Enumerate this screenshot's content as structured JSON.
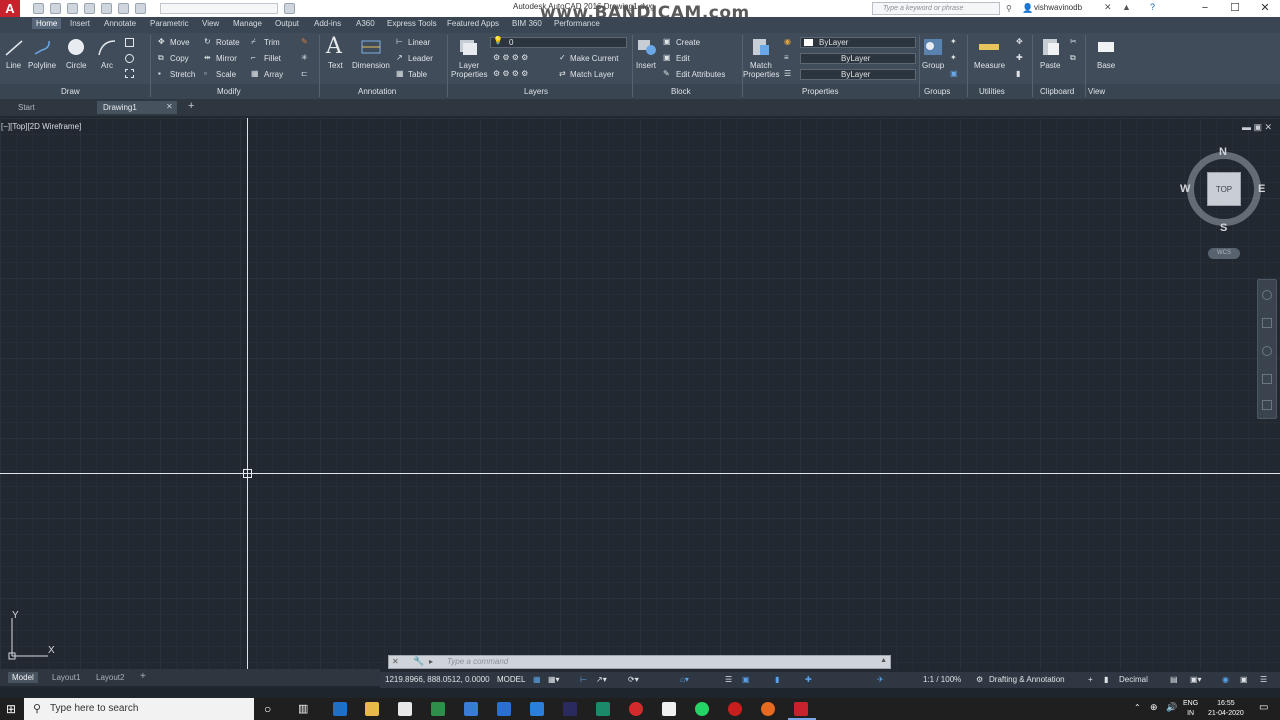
{
  "window": {
    "title": "Autodesk AutoCAD 2016    Drawing1.dwg",
    "watermark": "www.BANDICAM.com",
    "search_placeholder": "Type a keyword or phrase",
    "user": "vishwavinodb",
    "app_letter": "A"
  },
  "ribbon": {
    "tabs": [
      "Home",
      "Insert",
      "Annotate",
      "Parametric",
      "View",
      "Manage",
      "Output",
      "Add-ins",
      "A360",
      "Express Tools",
      "Featured Apps",
      "BIM 360",
      "Performance"
    ],
    "draw": {
      "line": "Line",
      "polyline": "Polyline",
      "circle": "Circle",
      "arc": "Arc",
      "title": "Draw"
    },
    "modify": {
      "move": "Move",
      "rotate": "Rotate",
      "trim": "Trim",
      "copy": "Copy",
      "mirror": "Mirror",
      "fillet": "Fillet",
      "stretch": "Stretch",
      "scale": "Scale",
      "array": "Array",
      "title": "Modify"
    },
    "annotation": {
      "text": "Text",
      "dimension": "Dimension",
      "linear": "Linear",
      "leader": "Leader",
      "table": "Table",
      "title": "Annotation"
    },
    "layers": {
      "layer_properties_1": "Layer",
      "layer_properties_2": "Properties",
      "layer_value": "0",
      "make_current": "Make Current",
      "match_layer": "Match Layer",
      "title": "Layers"
    },
    "block": {
      "insert": "Insert",
      "create": "Create",
      "edit": "Edit",
      "edit_attributes": "Edit Attributes",
      "title": "Block"
    },
    "properties": {
      "match_1": "Match",
      "match_2": "Properties",
      "color": "ByLayer",
      "linetype": "ByLayer",
      "lineweight": "ByLayer",
      "title": "Properties"
    },
    "groups": {
      "group": "Group",
      "title": "Groups"
    },
    "utilities": {
      "measure": "Measure",
      "title": "Utilities"
    },
    "clipboard": {
      "paste": "Paste",
      "title": "Clipboard"
    },
    "view": {
      "base": "Base",
      "title": "View"
    }
  },
  "file_tabs": {
    "start": "Start",
    "drawing": "Drawing1"
  },
  "viewport": {
    "label": "[−][Top][2D Wireframe]",
    "viewcube": {
      "top": "TOP",
      "n": "N",
      "s": "S",
      "e": "E",
      "w": "W",
      "wcs": "WCS"
    },
    "ucs_x": "X",
    "ucs_y": "Y"
  },
  "command": {
    "placeholder": "Type a command"
  },
  "layout_tabs": [
    "Model",
    "Layout1",
    "Layout2"
  ],
  "status": {
    "coords": "1219.8966, 888.0512, 0.0000",
    "model": "MODEL",
    "scale": "1:1 / 100%",
    "workspace": "Drafting & Annotation",
    "units": "Decimal"
  },
  "taskbar": {
    "search": "Type here to search",
    "lang_1": "ENG",
    "lang_2": "IN",
    "time": "16:55",
    "date": "21-04-2020"
  },
  "colors": {
    "accent": "#c8232c",
    "background": "#212830",
    "ribbon": "#404c5a"
  }
}
